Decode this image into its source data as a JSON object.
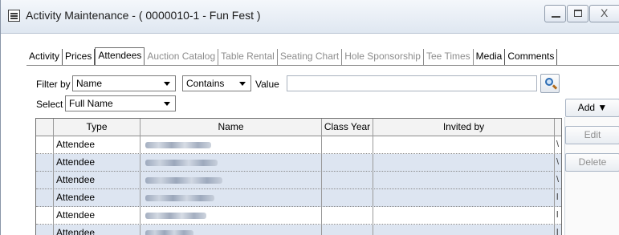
{
  "window": {
    "title": "Activity Maintenance - ( 0000010-1 - Fun Fest )",
    "icons": {
      "app": "list-window-icon",
      "minimize": "minimize-icon",
      "maximize": "maximize-icon",
      "close": "close-icon"
    },
    "close_glyph": "X"
  },
  "tabs": [
    {
      "label": "Activity",
      "state": "normal"
    },
    {
      "label": "Prices",
      "state": "normal"
    },
    {
      "label": "Attendees",
      "state": "active"
    },
    {
      "label": "Auction Catalog",
      "state": "disabled"
    },
    {
      "label": "Table Rental",
      "state": "disabled"
    },
    {
      "label": "Seating Chart",
      "state": "disabled"
    },
    {
      "label": "Hole Sponsorship",
      "state": "disabled"
    },
    {
      "label": "Tee Times",
      "state": "disabled"
    },
    {
      "label": "Media",
      "state": "normal"
    },
    {
      "label": "Comments",
      "state": "normal"
    }
  ],
  "filter": {
    "filter_by_label": "Filter by",
    "filter_by_value": "Name",
    "operator_value": "Contains",
    "value_label": "Value",
    "value_input": "",
    "select_label": "Select",
    "select_value": "Full Name"
  },
  "grid": {
    "columns": [
      "",
      "Type",
      "Name",
      "Class Year",
      "Invited by"
    ],
    "rows": [
      {
        "type": "Attendee",
        "name_obscured": true,
        "class_year": "",
        "invited_by": "",
        "edge": "\\"
      },
      {
        "type": "Attendee",
        "name_obscured": true,
        "class_year": "",
        "invited_by": "",
        "edge": "\\"
      },
      {
        "type": "Attendee",
        "name_obscured": true,
        "class_year": "",
        "invited_by": "",
        "edge": "\\"
      },
      {
        "type": "Attendee",
        "name_obscured": true,
        "class_year": "",
        "invited_by": "",
        "edge": "l"
      },
      {
        "type": "Attendee",
        "name_obscured": true,
        "class_year": "",
        "invited_by": "",
        "edge": "l"
      },
      {
        "type": "Attendee",
        "name_obscured": true,
        "class_year": "",
        "invited_by": "",
        "edge": "l"
      }
    ]
  },
  "actions": {
    "add": "Add ▼",
    "edit": "Edit",
    "delete": "Delete"
  },
  "colors": {
    "row_alt": "#dde5f1",
    "search_lens": "#2e6db4"
  }
}
